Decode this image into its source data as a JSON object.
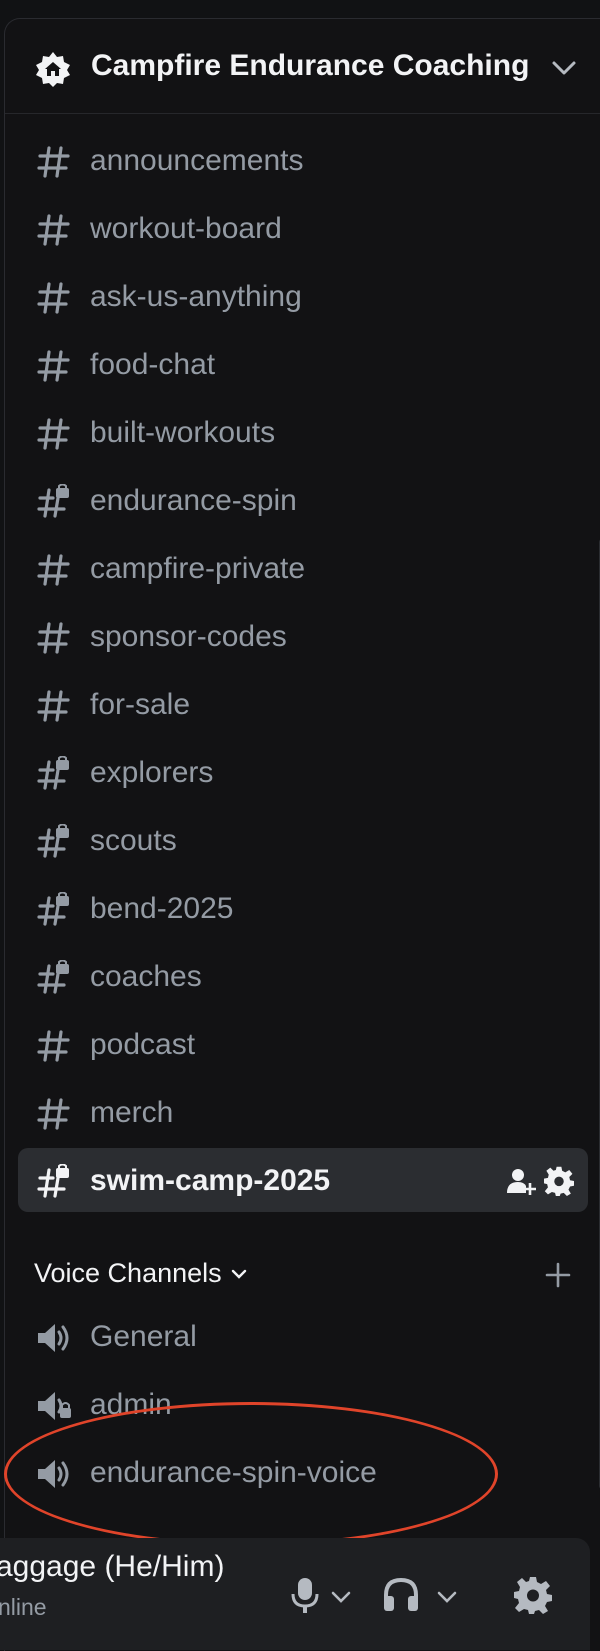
{
  "server": {
    "name": "Campfire Endurance Coaching"
  },
  "text_channels": [
    {
      "label": "announcements",
      "locked": false
    },
    {
      "label": "workout-board",
      "locked": false
    },
    {
      "label": "ask-us-anything",
      "locked": false
    },
    {
      "label": "food-chat",
      "locked": false
    },
    {
      "label": "built-workouts",
      "locked": false
    },
    {
      "label": "endurance-spin",
      "locked": true
    },
    {
      "label": "campfire-private",
      "locked": false
    },
    {
      "label": "sponsor-codes",
      "locked": false
    },
    {
      "label": "for-sale",
      "locked": false
    },
    {
      "label": "explorers",
      "locked": true
    },
    {
      "label": "scouts",
      "locked": true
    },
    {
      "label": "bend-2025",
      "locked": true
    },
    {
      "label": "coaches",
      "locked": true
    },
    {
      "label": "podcast",
      "locked": false
    },
    {
      "label": "merch",
      "locked": false
    },
    {
      "label": "swim-camp-2025",
      "locked": true,
      "selected": true
    }
  ],
  "voice_section": {
    "title": "Voice Channels"
  },
  "voice_channels": [
    {
      "label": "General",
      "locked": false
    },
    {
      "label": "admin",
      "locked": true
    },
    {
      "label": "endurance-spin-voice",
      "locked": false
    }
  ],
  "user": {
    "name": "aggage (He/Him)",
    "status": "nline"
  },
  "colors": {
    "background": "#121214",
    "selected": "#2b2d31",
    "text": "#949ba4",
    "bright": "#f2f3f5",
    "highlight": "#e0442a"
  }
}
